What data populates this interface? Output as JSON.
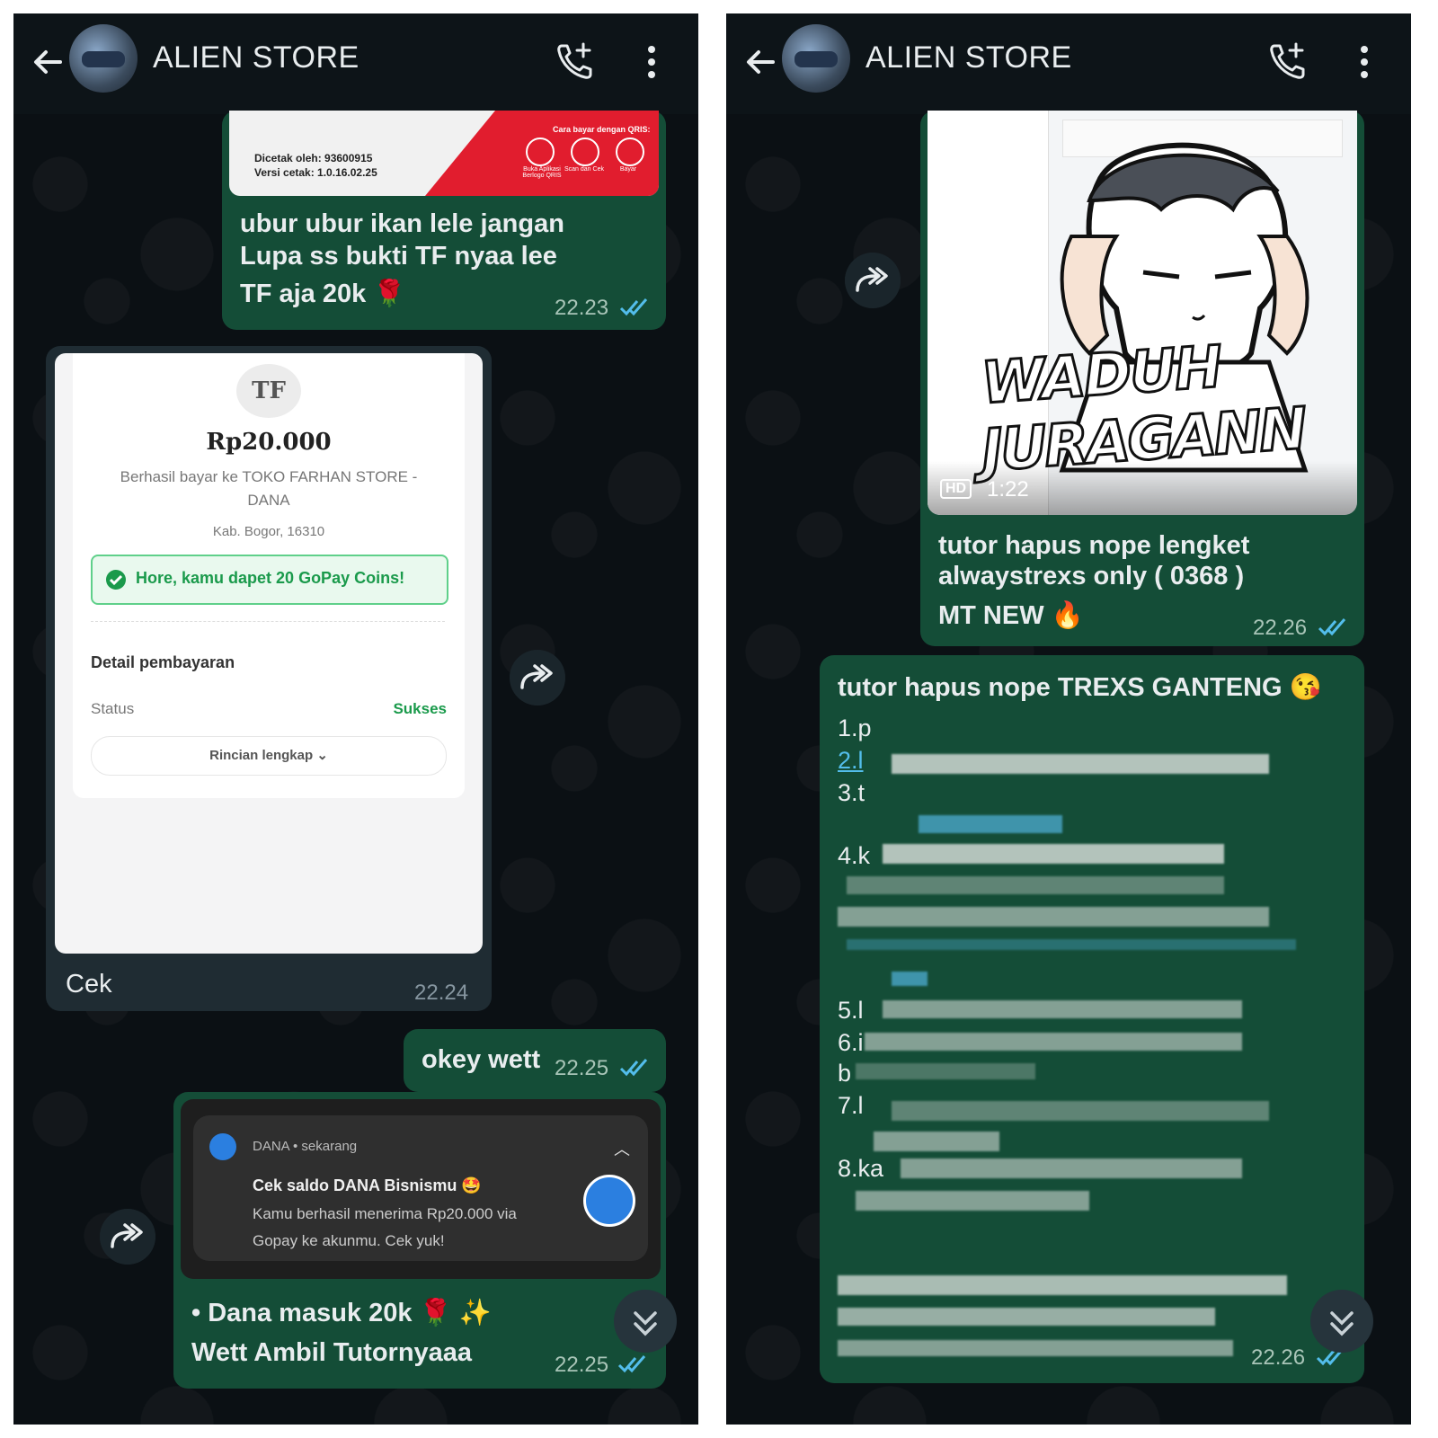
{
  "left": {
    "header": {
      "title": "ALIEN STORE"
    },
    "msg1": {
      "image_small_text": {
        "dicetak": "Dicetak oleh: 93600915",
        "versi": "Versi cetak: 1.0.16.02.25",
        "cara": "Cara bayar dengan QRIS:",
        "step1": "Buka Aplikasi Berlogo QRIS",
        "step2": "Scan dan Cek",
        "step3": "Bayar"
      },
      "line1": "ubur ubur ikan lele jangan",
      "line2": "Lupa ss bukti TF nyaa lee",
      "line3": "TF aja 20k 🌹",
      "time": "22.23"
    },
    "msg2": {
      "logo": "TF",
      "amount": "Rp20.000",
      "desc1": "Berhasil bayar ke TOKO FARHAN STORE -",
      "desc2": "DANA",
      "location": "Kab. Bogor, 16310",
      "coins": "Hore, kamu dapet 20 GoPay Coins!",
      "detail_title": "Detail pembayaran",
      "status_label": "Status",
      "status_value": "Sukses",
      "rincian": "Rincian lengkap",
      "caption": "Cek",
      "time": "22.24"
    },
    "msg3": {
      "text": "okey wett",
      "time": "22.25"
    },
    "msg4": {
      "notif_app": "DANA • sekarang",
      "notif_title": "Cek saldo DANA Bisnismu 🤩",
      "notif_body1": "Kamu berhasil menerima Rp20.000 via",
      "notif_body2": "Gopay ke akunmu. Cek yuk!",
      "line1": "• Dana masuk 20k 🌹 ✨",
      "line2": "Wett Ambil Tutornya​aa",
      "time": "22.25"
    }
  },
  "right": {
    "header": {
      "title": "ALIEN STORE"
    },
    "msg1": {
      "sticker_line1": "WADUH",
      "sticker_line2": "JURAGANN",
      "hd_label": "HD",
      "duration": "1:22",
      "line1": "tutor hapus nope lengket",
      "line2": "alwaystrexs only ( 0368 )",
      "line3": "MT NEW 🔥",
      "time": "22.26"
    },
    "msg2": {
      "title": "tutor hapus nope TREXS GANTENG 😘",
      "items": [
        "1.p",
        "2.l",
        "3.t",
        "4.k",
        "5.l",
        "6.i",
        "b",
        "7.l",
        "8.ka"
      ],
      "time": "22.26"
    }
  },
  "colors": {
    "outgoing": "#144d37",
    "incoming": "#1f2c33",
    "tick": "#53bdeb",
    "success": "#1a9a4b"
  }
}
